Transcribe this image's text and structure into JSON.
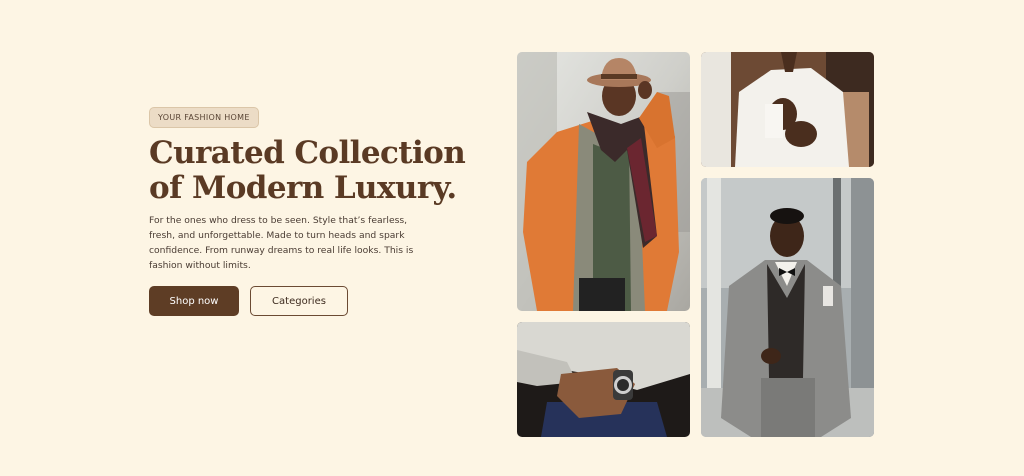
{
  "hero": {
    "badge": "YOUR FASHION HOME",
    "title_line1": "Curated Collection",
    "title_line2": "of Modern Luxury.",
    "description": "For the ones who dress to be seen. Style that’s fearless, fresh, and unforgettable. Made to turn heads and spark confidence. From runway dreams to real life looks. This is fashion without limits.",
    "primary_button": "Shop now",
    "secondary_button": "Categories"
  },
  "colors": {
    "background": "#fdf5e4",
    "accent": "#5e3d25",
    "badge_bg": "#ecdcc6",
    "heading": "#5a3a24"
  }
}
